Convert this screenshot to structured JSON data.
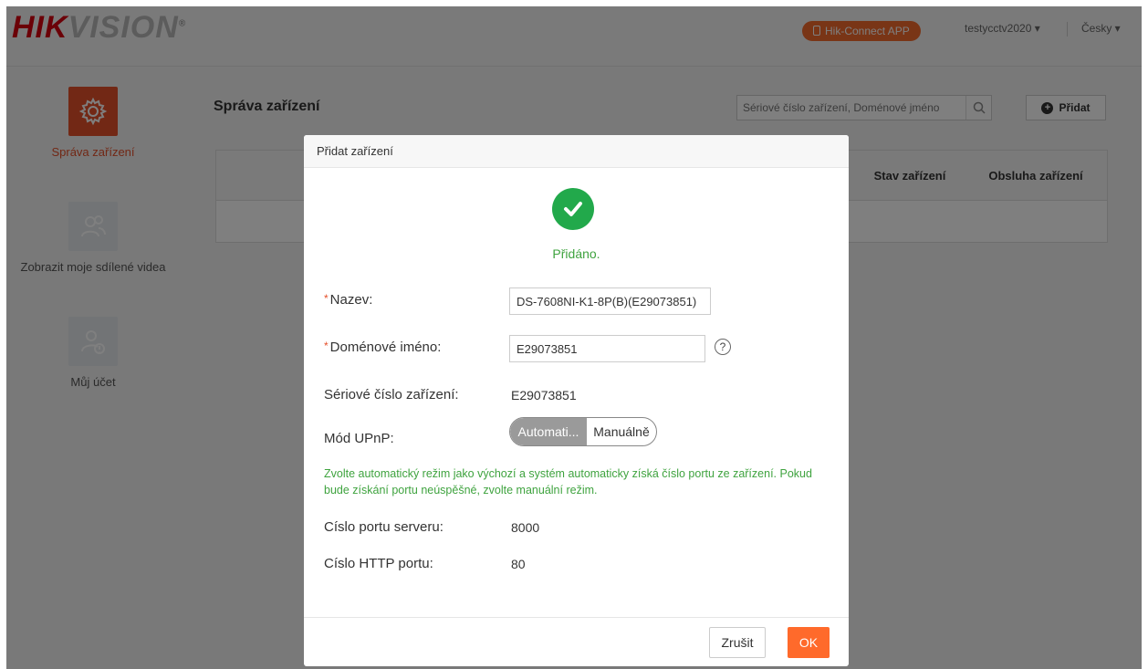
{
  "header": {
    "logo_red": "HIK",
    "logo_gray": "VISION",
    "app_button": "Hik-Connect APP",
    "user": "testycctv2020",
    "language": "Česky"
  },
  "sidebar": {
    "items": [
      {
        "label": "Správa zařízení",
        "icon": "gear-icon"
      },
      {
        "label": "Zobrazit moje sdílené videa",
        "icon": "shared-users-icon"
      },
      {
        "label": "Můj účet",
        "icon": "account-icon"
      }
    ]
  },
  "main": {
    "title": "Správa zařízení",
    "search_placeholder": "Sériové číslo zařízení, Doménové jméno",
    "add_label": "Přidat",
    "table_headers": [
      "Stav zařízení",
      "Obsluha zařízení"
    ]
  },
  "dialog": {
    "title": "Přidat zařízení",
    "success_text": "Přidáno.",
    "name_label": "Nazev:",
    "name_value": "DS-7608NI-K1-8P(B)(E29073851)",
    "domain_label": "Doménové iméno:",
    "domain_value": "E29073851",
    "help": "?",
    "serial_label": "Sériové číslo zařízení:",
    "serial_value": "E29073851",
    "upnp_label": "Mód UPnP:",
    "upnp_auto": "Automati...",
    "upnp_manual": "Manuálně",
    "hint": "Zvolte automatický režim jako výchozí a systém automaticky získá číslo portu ze zařízení. Pokud bude získání portu neúspěšné, zvolte manuální režim.",
    "server_port_label": "Císlo portu serveru:",
    "server_port_value": "8000",
    "http_port_label": "Císlo HTTP portu:",
    "http_port_value": "80",
    "cancel_label": "Zrušit",
    "ok_label": "OK"
  },
  "colors": {
    "accent": "#ff6a2b",
    "success": "#22a94b",
    "brand_red": "#d7000f"
  }
}
